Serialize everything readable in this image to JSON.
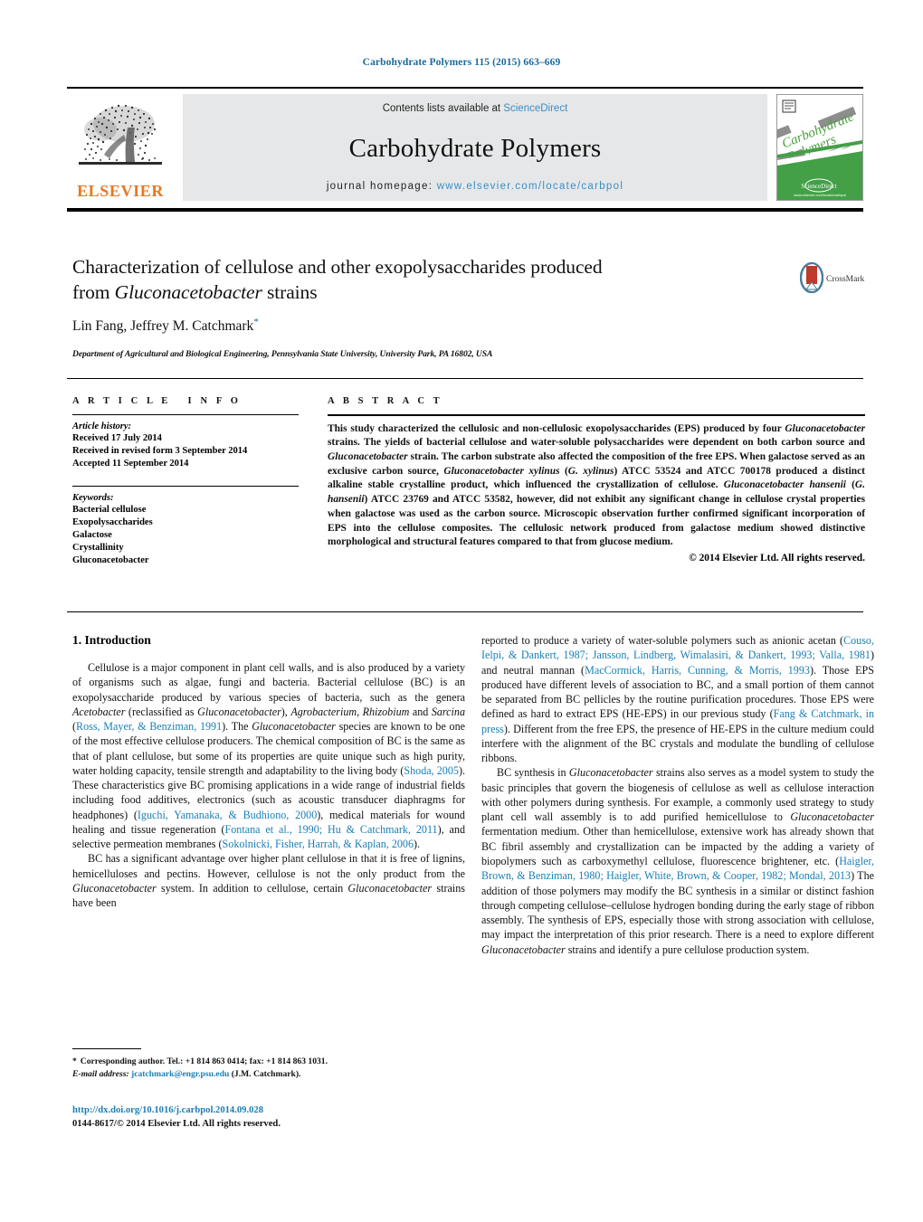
{
  "running_head": "Carbohydrate Polymers 115 (2015) 663–669",
  "masthead": {
    "publisher_name": "ELSEVIER",
    "contents_prefix": "Contents lists available at ",
    "contents_link": "ScienceDirect",
    "journal_name": "Carbohydrate Polymers",
    "homepage_prefix": "journal homepage: ",
    "homepage_url": "www.elsevier.com/locate/carbpol",
    "cover_title_line1": "Carbohydrate",
    "cover_title_line2": "Polymers"
  },
  "title": {
    "line1": "Characterization of cellulose and other exopolysaccharides produced",
    "line2_pre": "from ",
    "line2_italic": "Gluconacetobacter",
    "line2_post": " strains"
  },
  "crossmark": {
    "label": "CrossMark"
  },
  "authors": "Lin Fang, Jeffrey M. Catchmark",
  "affiliation": "Department of Agricultural and Biological Engineering, Pennsylvania State University, University Park, PA 16802, USA",
  "article_info": {
    "heading": "ARTICLE INFO",
    "history_label": "Article history:",
    "history": [
      "Received 17 July 2014",
      "Received in revised form 3 September 2014",
      "Accepted 11 September 2014"
    ],
    "keywords_label": "Keywords:",
    "keywords": [
      "Bacterial cellulose",
      "Exopolysaccharides",
      "Galactose",
      "Crystallinity",
      "Gluconacetobacter"
    ]
  },
  "abstract": {
    "heading": "ABSTRACT",
    "p1": "This study characterized the cellulosic and non-cellulosic exopolysaccharides (EPS) produced by four ",
    "i1": "Gluconacetobacter",
    "p2": " strains. The yields of bacterial cellulose and water-soluble polysaccharides were dependent on both carbon source and ",
    "i2": "Gluconacetobacter",
    "p3": " strain. The carbon substrate also affected the composition of the free EPS. When galactose served as an exclusive carbon source, ",
    "i3": "Gluconacetobacter xylinus",
    "p4": " (",
    "i4": "G. xylinus",
    "p5": ") ATCC 53524 and ATCC 700178 produced a distinct alkaline stable crystalline product, which influenced the crystallization of cellulose. ",
    "i5": "Gluconacetobacter hansenii",
    "p6": " (",
    "i6": "G. hansenii",
    "p7": ") ATCC 23769 and ATCC 53582, however, did not exhibit any significant change in cellulose crystal properties when galactose was used as the carbon source. Microscopic observation further confirmed significant incorporation of EPS into the cellulose composites. The cellulosic network produced from galactose medium showed distinctive morphological and structural features compared to that from glucose medium.",
    "copyright": "© 2014 Elsevier Ltd. All rights reserved."
  },
  "intro": {
    "heading": "1. Introduction",
    "left": {
      "p1": {
        "t1": "Cellulose is a major component in plant cell walls, and is also produced by a variety of organisms such as algae, fungi and bacteria. Bacterial cellulose (BC) is an exopolysaccharide produced by various species of bacteria, such as the genera ",
        "i1": "Acetobacter",
        "t2": " (reclassified as ",
        "i2": "Gluconacetobacter",
        "t3": "), ",
        "i3": "Agrobacterium, Rhizobium",
        "t4": " and ",
        "i4": "Sarcina",
        "t5": " (",
        "r1": "Ross, Mayer, & Benziman, 1991",
        "t6": "). The ",
        "i5": "Gluconacetobacter",
        "t7": " species are known to be one of the most effective cellulose producers. The chemical composition of BC is the same as that of plant cellulose, but some of its properties are quite unique such as high purity, water holding capacity, tensile strength and adaptability to the living body (",
        "r2": "Shoda, 2005",
        "t8": "). These characteristics give BC promising applications in a wide range of industrial fields including food additives, electronics (such as acoustic transducer diaphragms for headphones) (",
        "r3": "Iguchi, Yamanaka, & Budhiono, 2000",
        "t9": "), medical materials for wound healing and tissue regeneration (",
        "r4": "Fontana et al., 1990; Hu & Catchmark, 2011",
        "t10": "), and selective permeation membranes (",
        "r5": "Sokolnicki, Fisher, Harrah, & Kaplan, 2006",
        "t11": ")."
      },
      "p2": {
        "t1": "BC has a significant advantage over higher plant cellulose in that it is free of lignins, hemicelluloses and pectins. However, cellulose is not the only product from the ",
        "i1": "Gluconacetobacter",
        "t2": " system. In addition to cellulose, certain ",
        "i2": "Gluconacetobacter",
        "t3": " strains have been"
      }
    },
    "right": {
      "p1": {
        "t1": "reported to produce a variety of water-soluble polymers such as anionic acetan (",
        "r1": "Couso, Ielpi, & Dankert, 1987; Jansson, Lindberg, Wimalasiri, & Dankert, 1993; Valla, 1981",
        "t2": ") and neutral mannan (",
        "r2": "MacCormick, Harris, Cunning, & Morris, 1993",
        "t3": "). Those EPS produced have different levels of association to BC, and a small portion of them cannot be separated from BC pellicles by the routine purification procedures. Those EPS were defined as hard to extract EPS (HE-EPS) in our previous study (",
        "r3": "Fang & Catchmark, in press",
        "t4": "). Different from the free EPS, the presence of HE-EPS in the culture medium could interfere with the alignment of the BC crystals and modulate the bundling of cellulose ribbons."
      },
      "p2": {
        "t1": "BC synthesis in ",
        "i1": "Gluconacetobacter",
        "t2": " strains also serves as a model system to study the basic principles that govern the biogenesis of cellulose as well as cellulose interaction with other polymers during synthesis. For example, a commonly used strategy to study plant cell wall assembly is to add purified hemicellulose to ",
        "i2": "Gluconacetobacter",
        "t3": " fermentation medium. Other than hemicellulose, extensive work has already shown that BC fibril assembly and crystallization can be impacted by the adding a variety of biopolymers such as carboxymethyl cellulose, fluorescence brightener, etc. (",
        "r1": "Haigler, Brown, & Benziman, 1980; Haigler, White, Brown, & Cooper, 1982; Mondal, 2013",
        "t4": ") The addition of those polymers may modify the BC synthesis in a similar or distinct fashion through competing cellulose–cellulose hydrogen bonding during the early stage of ribbon assembly. The synthesis of EPS, especially those with strong association with cellulose, may impact the interpretation of this prior research. There is a need to explore different ",
        "i3": "Gluconacetobacter",
        "t5": " strains and identify a pure cellulose production system."
      }
    }
  },
  "footnote": {
    "corresponding": "Corresponding author. Tel.: +1 814 863 0414; fax: +1 814 863 1031.",
    "email_label": "E-mail address:",
    "email": "jcatchmark@engr.psu.edu",
    "email_owner": "(J.M. Catchmark)."
  },
  "doi": "http://dx.doi.org/10.1016/j.carbpol.2014.09.028",
  "issn_line": "0144-8617/© 2014 Elsevier Ltd. All rights reserved.",
  "colors": {
    "link_blue": "#1a7fb5",
    "header_blue": "#1a6a9c",
    "elsevier_orange": "#E87722",
    "masthead_gray": "#e6e7e8",
    "crossmark_blue": "#4a7b96",
    "crossmark_red": "#c0392b"
  }
}
